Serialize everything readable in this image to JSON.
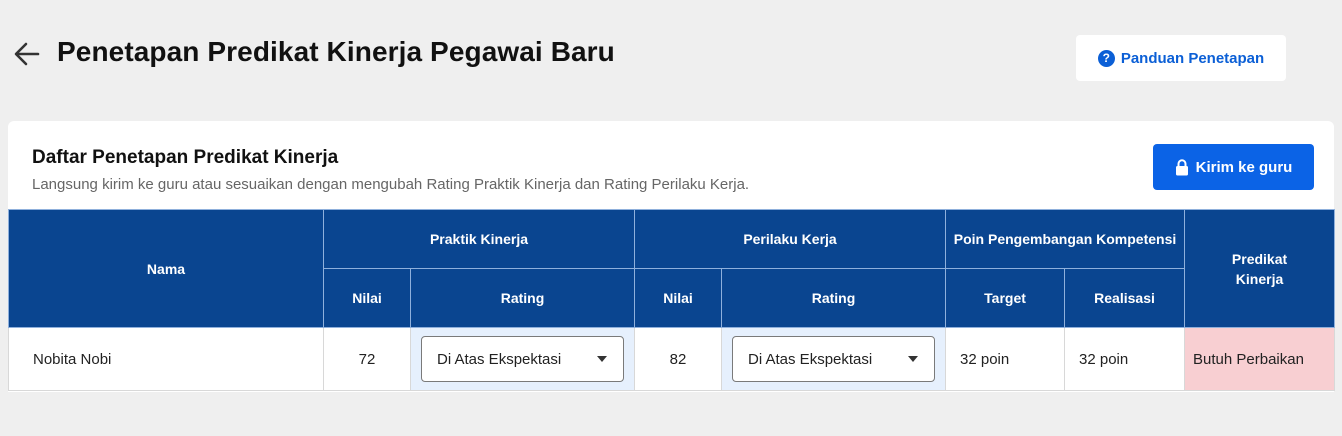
{
  "header": {
    "title": "Penetapan Predikat Kinerja Pegawai Baru",
    "guide_label": "Panduan Penetapan"
  },
  "card": {
    "title": "Daftar Penetapan Predikat Kinerja",
    "subtitle": "Langsung kirim ke guru atau sesuaikan dengan mengubah Rating Praktik Kinerja dan Rating Perilaku Kerja.",
    "send_label": "Kirim ke guru"
  },
  "table": {
    "col_nama": "Nama",
    "group_praktik": "Praktik Kinerja",
    "group_perilaku": "Perilaku Kerja",
    "group_poin": "Poin Pengembangan Kompetensi",
    "col_predikat": "Predikat Kinerja",
    "sub_nilai": "Nilai",
    "sub_rating": "Rating",
    "sub_target": "Target",
    "sub_realisasi": "Realisasi",
    "rows": [
      {
        "nama": "Nobita Nobi",
        "praktik_nilai": "72",
        "praktik_rating": "Di Atas Ekspektasi",
        "perilaku_nilai": "82",
        "perilaku_rating": "Di Atas Ekspektasi",
        "target": "32 poin",
        "realisasi": "32 poin",
        "predikat": "Butuh Perbaikan"
      }
    ]
  },
  "colors": {
    "primary": "#0b63e6",
    "header_bg": "#0a4590",
    "rating_cell_bg": "#e6f0fd",
    "predikat_bad_bg": "#f8cfd2"
  }
}
